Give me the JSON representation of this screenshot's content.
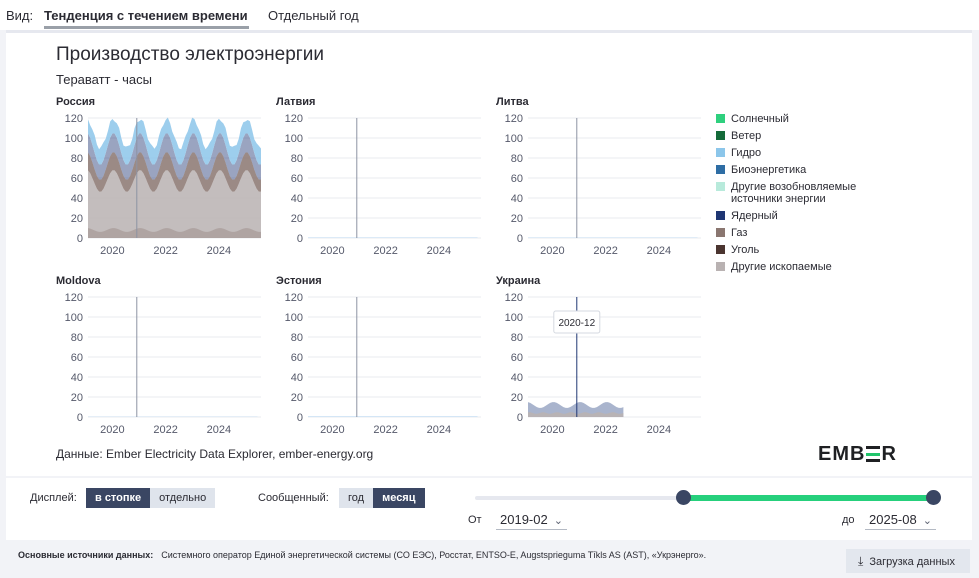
{
  "header": {
    "view_label": "Вид:",
    "tab_trend": "Тенденция с течением времени",
    "tab_year": "Отдельный год"
  },
  "chart": {
    "title": "Производство электроэнергии",
    "subtitle": "Тераватт - часы",
    "source": "Данные: Ember Electricity Data Explorer, ember-energy.org",
    "logo": {
      "left": "EMB",
      "right": "R"
    }
  },
  "legend": [
    {
      "label": "Солнечный",
      "color": "#2ed07e"
    },
    {
      "label": "Ветер",
      "color": "#146b3a"
    },
    {
      "label": "Гидро",
      "color": "#8cc6ea"
    },
    {
      "label": "Биоэнергетика",
      "color": "#2e6da4"
    },
    {
      "label": "Другие возобновляемые источники энергии",
      "color": "#b8eadb"
    },
    {
      "label": "Ядерный",
      "color": "#1f3673"
    },
    {
      "label": "Газ",
      "color": "#8a7670"
    },
    {
      "label": "Уголь",
      "color": "#4b3530"
    },
    {
      "label": "Другие ископаемые",
      "color": "#b9b2b2"
    }
  ],
  "chart_data": [
    {
      "type": "area",
      "title": "Россия",
      "x_ticks": [
        "2020",
        "2022",
        "2024"
      ],
      "y_ticks": [
        0,
        20,
        40,
        60,
        80,
        100,
        120
      ],
      "ylim": [
        0,
        120
      ],
      "x_range": [
        "2019-02",
        "2025-08"
      ],
      "cursor": "2020-12",
      "monthly_total_twh": {
        "summer_min": 77,
        "winter_max": 110
      },
      "series": [
        {
          "name": "Другие ископаемые",
          "summer": 46,
          "winter": 68
        },
        {
          "name": "Газ",
          "summer": 12,
          "winter": 18
        },
        {
          "name": "Ядерный",
          "summer": 15,
          "winter": 19
        },
        {
          "name": "Гидро",
          "summer": 17,
          "winter": 14
        }
      ]
    },
    {
      "type": "area",
      "title": "Латвия",
      "x_ticks": [
        "2020",
        "2022",
        "2024"
      ],
      "y_ticks": [
        0,
        20,
        40,
        60,
        80,
        100,
        120
      ],
      "ylim": [
        0,
        120
      ],
      "monthly_total_twh": 0.5
    },
    {
      "type": "area",
      "title": "Литва",
      "x_ticks": [
        "2020",
        "2022",
        "2024"
      ],
      "y_ticks": [
        0,
        20,
        40,
        60,
        80,
        100,
        120
      ],
      "ylim": [
        0,
        120
      ],
      "monthly_total_twh": 0.4
    },
    {
      "type": "area",
      "title": "Moldova",
      "x_ticks": [
        "2020",
        "2022",
        "2024"
      ],
      "y_ticks": [
        0,
        20,
        40,
        60,
        80,
        100,
        120
      ],
      "ylim": [
        0,
        120
      ],
      "monthly_total_twh": 0.3
    },
    {
      "type": "area",
      "title": "Эстония",
      "x_ticks": [
        "2020",
        "2022",
        "2024"
      ],
      "y_ticks": [
        0,
        20,
        40,
        60,
        80,
        100,
        120
      ],
      "ylim": [
        0,
        120
      ],
      "monthly_total_twh": 0.6
    },
    {
      "type": "area",
      "title": "Украина",
      "x_ticks": [
        "2020",
        "2022",
        "2024"
      ],
      "y_ticks": [
        0,
        20,
        40,
        60,
        80,
        100,
        120
      ],
      "ylim": [
        0,
        120
      ],
      "data_end": "2022-09",
      "monthly_total_twh": {
        "min": 9,
        "max": 15
      },
      "tooltip": "2020-12"
    }
  ],
  "controls": {
    "display_label": "Дисплей:",
    "display_stacked": "в стопке",
    "display_separate": "отдельно",
    "reported_label": "Сообщенный:",
    "reported_year": "год",
    "reported_month": "месяц",
    "from_label": "От",
    "from_value": "2019-02",
    "to_label": "до",
    "to_value": "2025-08"
  },
  "footer": {
    "sources_label": "Основные источники данных:",
    "sources_text": "Системного оператор Единой энергетической системы (СО ЕЭС), Росстат, ENTSO-E, Augstsprieguma Tīkls AS (AST), «Укрэнерго».",
    "download_label": "Загрузка данных"
  }
}
